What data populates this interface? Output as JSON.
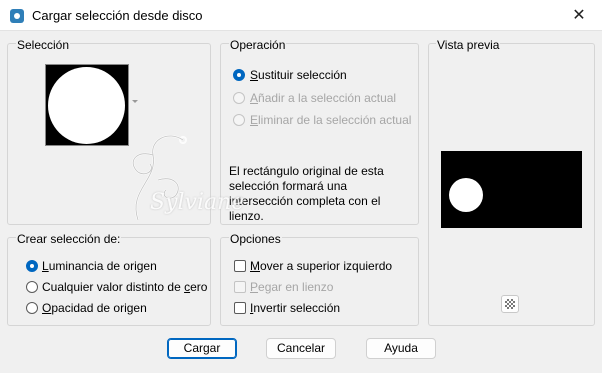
{
  "window": {
    "title": "Cargar selección desde disco",
    "close_glyph": "✕"
  },
  "seleccion": {
    "label": "Selección"
  },
  "operacion": {
    "label": "Operación",
    "options": [
      {
        "pre": "",
        "key": "S",
        "rest": "ustituir selección",
        "checked": true,
        "disabled": false
      },
      {
        "pre": "",
        "key": "A",
        "rest": "ñadir a la selección actual",
        "checked": false,
        "disabled": true
      },
      {
        "pre": "",
        "key": "E",
        "rest": "liminar de la selección actual",
        "checked": false,
        "disabled": true
      }
    ],
    "description": "El rectángulo original de esta selección formará una intersección completa con el lienzo."
  },
  "preview": {
    "label": "Vista previa"
  },
  "crear": {
    "label_pre": "Crear selección de:",
    "options": [
      {
        "pre": "",
        "key": "L",
        "rest": "uminancia de origen",
        "checked": true
      },
      {
        "pre": "Cualquier valor distinto de ",
        "key": "c",
        "rest": "ero",
        "checked": false
      },
      {
        "pre": "",
        "key": "O",
        "rest": "pacidad de origen",
        "checked": false
      }
    ]
  },
  "opciones": {
    "label": "Opciones",
    "items": [
      {
        "pre": "",
        "key": "M",
        "rest": "over a superior izquierdo",
        "checked": false,
        "disabled": false
      },
      {
        "pre": "",
        "key": "P",
        "rest": "egar en lienzo",
        "checked": false,
        "disabled": true
      },
      {
        "pre": "",
        "key": "I",
        "rest": "nvertir selección",
        "checked": false,
        "disabled": false
      }
    ]
  },
  "buttons": {
    "cargar": "Cargar",
    "cancelar": "Cancelar",
    "ayuda": "Ayuda"
  },
  "watermark": "Sylviane",
  "colors": {
    "accent": "#0067c0",
    "disabled": "#a6a6a6"
  }
}
